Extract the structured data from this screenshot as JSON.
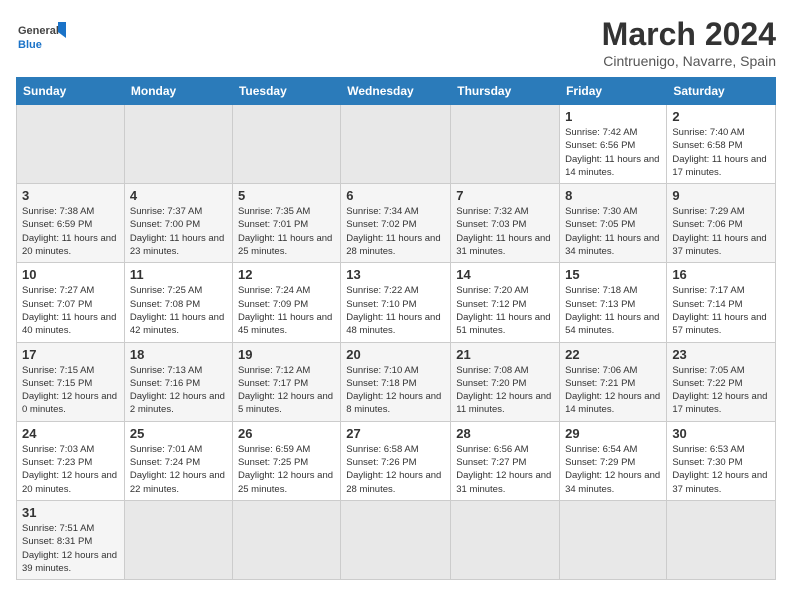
{
  "header": {
    "logo_general": "General",
    "logo_blue": "Blue",
    "month_year": "March 2024",
    "location": "Cintruenigo, Navarre, Spain"
  },
  "weekdays": [
    "Sunday",
    "Monday",
    "Tuesday",
    "Wednesday",
    "Thursday",
    "Friday",
    "Saturday"
  ],
  "weeks": [
    [
      {
        "day": "",
        "info": ""
      },
      {
        "day": "",
        "info": ""
      },
      {
        "day": "",
        "info": ""
      },
      {
        "day": "",
        "info": ""
      },
      {
        "day": "",
        "info": ""
      },
      {
        "day": "1",
        "info": "Sunrise: 7:42 AM\nSunset: 6:56 PM\nDaylight: 11 hours and 14 minutes."
      },
      {
        "day": "2",
        "info": "Sunrise: 7:40 AM\nSunset: 6:58 PM\nDaylight: 11 hours and 17 minutes."
      }
    ],
    [
      {
        "day": "3",
        "info": "Sunrise: 7:38 AM\nSunset: 6:59 PM\nDaylight: 11 hours and 20 minutes."
      },
      {
        "day": "4",
        "info": "Sunrise: 7:37 AM\nSunset: 7:00 PM\nDaylight: 11 hours and 23 minutes."
      },
      {
        "day": "5",
        "info": "Sunrise: 7:35 AM\nSunset: 7:01 PM\nDaylight: 11 hours and 25 minutes."
      },
      {
        "day": "6",
        "info": "Sunrise: 7:34 AM\nSunset: 7:02 PM\nDaylight: 11 hours and 28 minutes."
      },
      {
        "day": "7",
        "info": "Sunrise: 7:32 AM\nSunset: 7:03 PM\nDaylight: 11 hours and 31 minutes."
      },
      {
        "day": "8",
        "info": "Sunrise: 7:30 AM\nSunset: 7:05 PM\nDaylight: 11 hours and 34 minutes."
      },
      {
        "day": "9",
        "info": "Sunrise: 7:29 AM\nSunset: 7:06 PM\nDaylight: 11 hours and 37 minutes."
      }
    ],
    [
      {
        "day": "10",
        "info": "Sunrise: 7:27 AM\nSunset: 7:07 PM\nDaylight: 11 hours and 40 minutes."
      },
      {
        "day": "11",
        "info": "Sunrise: 7:25 AM\nSunset: 7:08 PM\nDaylight: 11 hours and 42 minutes."
      },
      {
        "day": "12",
        "info": "Sunrise: 7:24 AM\nSunset: 7:09 PM\nDaylight: 11 hours and 45 minutes."
      },
      {
        "day": "13",
        "info": "Sunrise: 7:22 AM\nSunset: 7:10 PM\nDaylight: 11 hours and 48 minutes."
      },
      {
        "day": "14",
        "info": "Sunrise: 7:20 AM\nSunset: 7:12 PM\nDaylight: 11 hours and 51 minutes."
      },
      {
        "day": "15",
        "info": "Sunrise: 7:18 AM\nSunset: 7:13 PM\nDaylight: 11 hours and 54 minutes."
      },
      {
        "day": "16",
        "info": "Sunrise: 7:17 AM\nSunset: 7:14 PM\nDaylight: 11 hours and 57 minutes."
      }
    ],
    [
      {
        "day": "17",
        "info": "Sunrise: 7:15 AM\nSunset: 7:15 PM\nDaylight: 12 hours and 0 minutes."
      },
      {
        "day": "18",
        "info": "Sunrise: 7:13 AM\nSunset: 7:16 PM\nDaylight: 12 hours and 2 minutes."
      },
      {
        "day": "19",
        "info": "Sunrise: 7:12 AM\nSunset: 7:17 PM\nDaylight: 12 hours and 5 minutes."
      },
      {
        "day": "20",
        "info": "Sunrise: 7:10 AM\nSunset: 7:18 PM\nDaylight: 12 hours and 8 minutes."
      },
      {
        "day": "21",
        "info": "Sunrise: 7:08 AM\nSunset: 7:20 PM\nDaylight: 12 hours and 11 minutes."
      },
      {
        "day": "22",
        "info": "Sunrise: 7:06 AM\nSunset: 7:21 PM\nDaylight: 12 hours and 14 minutes."
      },
      {
        "day": "23",
        "info": "Sunrise: 7:05 AM\nSunset: 7:22 PM\nDaylight: 12 hours and 17 minutes."
      }
    ],
    [
      {
        "day": "24",
        "info": "Sunrise: 7:03 AM\nSunset: 7:23 PM\nDaylight: 12 hours and 20 minutes."
      },
      {
        "day": "25",
        "info": "Sunrise: 7:01 AM\nSunset: 7:24 PM\nDaylight: 12 hours and 22 minutes."
      },
      {
        "day": "26",
        "info": "Sunrise: 6:59 AM\nSunset: 7:25 PM\nDaylight: 12 hours and 25 minutes."
      },
      {
        "day": "27",
        "info": "Sunrise: 6:58 AM\nSunset: 7:26 PM\nDaylight: 12 hours and 28 minutes."
      },
      {
        "day": "28",
        "info": "Sunrise: 6:56 AM\nSunset: 7:27 PM\nDaylight: 12 hours and 31 minutes."
      },
      {
        "day": "29",
        "info": "Sunrise: 6:54 AM\nSunset: 7:29 PM\nDaylight: 12 hours and 34 minutes."
      },
      {
        "day": "30",
        "info": "Sunrise: 6:53 AM\nSunset: 7:30 PM\nDaylight: 12 hours and 37 minutes."
      }
    ],
    [
      {
        "day": "31",
        "info": "Sunrise: 7:51 AM\nSunset: 8:31 PM\nDaylight: 12 hours and 39 minutes."
      },
      {
        "day": "",
        "info": ""
      },
      {
        "day": "",
        "info": ""
      },
      {
        "day": "",
        "info": ""
      },
      {
        "day": "",
        "info": ""
      },
      {
        "day": "",
        "info": ""
      },
      {
        "day": "",
        "info": ""
      }
    ]
  ]
}
